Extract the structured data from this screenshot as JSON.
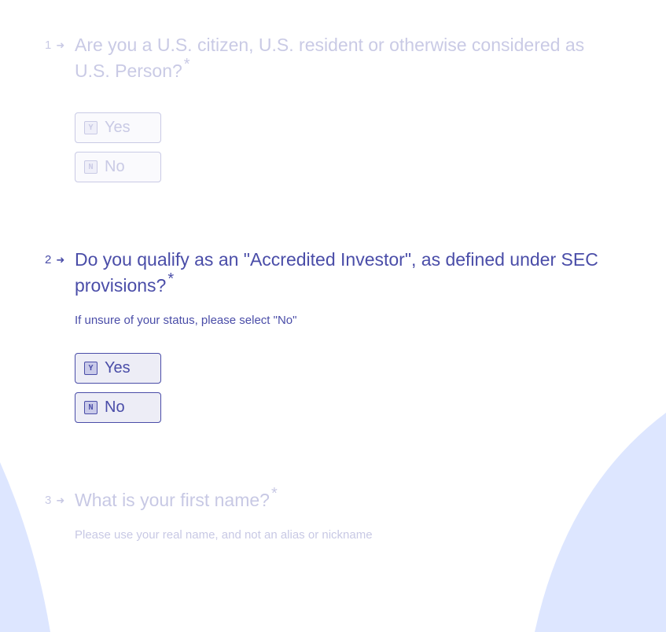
{
  "colors": {
    "accent": "#4a4da8",
    "background": "#ffffff",
    "arc": "#dde6ff"
  },
  "questions": [
    {
      "number": "1",
      "arrow_icon": "arrow-right-icon",
      "title": "Are you a U.S. citizen, U.S. resident or otherwise considered as U.S. Person?",
      "required_mark": "*",
      "description": "",
      "choices": [
        {
          "key": "Y",
          "label": "Yes"
        },
        {
          "key": "N",
          "label": "No"
        }
      ]
    },
    {
      "number": "2",
      "arrow_icon": "arrow-right-icon",
      "title": "Do you qualify as an \"Accredited Investor\", as defined under SEC provisions?",
      "required_mark": "*",
      "description": "If unsure of your status, please select \"No\"",
      "choices": [
        {
          "key": "Y",
          "label": "Yes"
        },
        {
          "key": "N",
          "label": "No"
        }
      ]
    },
    {
      "number": "3",
      "arrow_icon": "arrow-right-icon",
      "title": "What is your first name?",
      "required_mark": "*",
      "description": "Please use your real name, and not an alias or nickname",
      "choices": []
    }
  ]
}
